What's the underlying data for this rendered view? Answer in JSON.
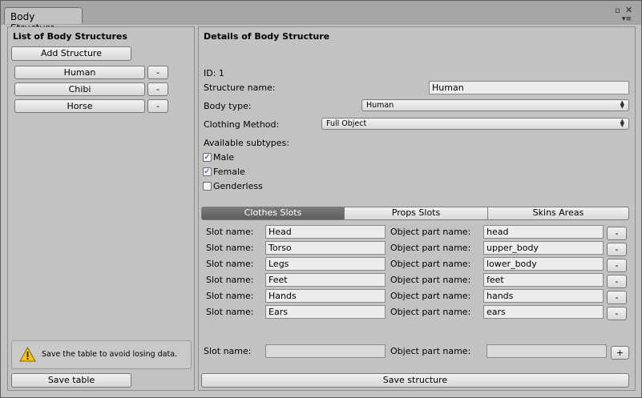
{
  "window": {
    "tab_title": "Body Structure"
  },
  "left": {
    "heading": "List of Body Structures",
    "add_button": "Add Structure",
    "items": [
      {
        "label": "Human",
        "remove": "-"
      },
      {
        "label": "Chibi",
        "remove": "-"
      },
      {
        "label": "Horse",
        "remove": "-"
      }
    ],
    "warning": "Save the table to avoid losing data.",
    "save_button": "Save table"
  },
  "details": {
    "heading": "Details of Body Structure",
    "id_text": "ID: 1",
    "structure_name_label": "Structure name:",
    "structure_name_value": "Human",
    "body_type_label": "Body type:",
    "body_type_value": "Human",
    "clothing_label": "Clothing Method:",
    "clothing_value": "Full Object",
    "subtypes_label": "Available subtypes:",
    "subtypes": [
      {
        "label": "Male",
        "checked": true
      },
      {
        "label": "Female",
        "checked": true
      },
      {
        "label": "Genderless",
        "checked": false
      }
    ],
    "tabs": [
      "Clothes Slots",
      "Props Slots",
      "Skins Areas"
    ],
    "active_tab": "Clothes Slots",
    "slot_label": "Slot name:",
    "part_label": "Object part name:",
    "slots": [
      {
        "slot": "Head",
        "part": "head",
        "remove": "-"
      },
      {
        "slot": "Torso",
        "part": "upper_body",
        "remove": "-"
      },
      {
        "slot": "Legs",
        "part": "lower_body",
        "remove": "-"
      },
      {
        "slot": "Feet",
        "part": "feet",
        "remove": "-"
      },
      {
        "slot": "Hands",
        "part": "hands",
        "remove": "-"
      },
      {
        "slot": "Ears",
        "part": "ears",
        "remove": "-"
      }
    ],
    "new_slot": {
      "slot": "",
      "part": "",
      "add": "+"
    },
    "save_button": "Save structure"
  },
  "icons": {
    "maximize": "maximize-icon",
    "close": "close-icon",
    "menu": "menu-icon",
    "warning": "warning-icon"
  },
  "colors": {
    "active_tab": "#6a6a6a",
    "warning": "#f2c21a",
    "checkmark": "#1d3c7a"
  }
}
